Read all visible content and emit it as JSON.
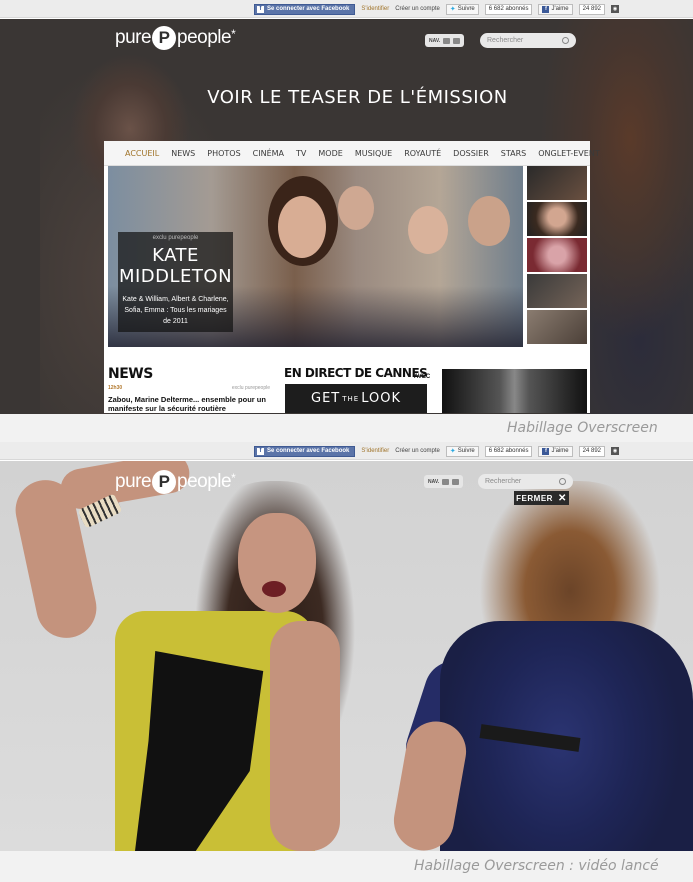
{
  "top_bar": {
    "facebook_connect": "Se connecter avec Facebook",
    "login": "S'identifier",
    "create_account": "Créer un compte",
    "twitter_follow": "Suivre",
    "twitter_count": "6 682 abonnés",
    "fb_like": "J'aime",
    "fb_like_count": "24 892"
  },
  "logo": {
    "left": "pure",
    "disc": "P",
    "right": "people",
    "star": "*"
  },
  "header": {
    "nav_label": "NAV.",
    "search_placeholder": "Rechercher"
  },
  "panel1": {
    "teaser": "VOIR LE TEASER DE L'ÉMISSION",
    "nav_items": [
      "ACCUEIL",
      "NEWS",
      "PHOTOS",
      "CINÉMA",
      "TV",
      "MODE",
      "MUSIQUE",
      "ROYAUTÉ",
      "DOSSIER",
      "STARS",
      "ONGLET-EVENT"
    ],
    "hero": {
      "exclu": "exclu purepeople",
      "name_line1": "KATE",
      "name_line2": "MIDDLETON",
      "subtitle": "Kate & William, Albert & Charlene, Sofia, Emma : Tous les mariages de 2011"
    },
    "news": {
      "title": "NEWS",
      "time": "12h30",
      "exclu": "exclu purepeople",
      "headline": "Zabou, Marine Delterme... ensemble pour un manifeste sur la sécurité routière"
    },
    "cannes": {
      "title": "EN DIRECT DE CANNES",
      "avec": "AVEC",
      "get": "GET",
      "the": "THE",
      "look": "LOOK"
    }
  },
  "captions": {
    "panel1": "Habillage Overscreen",
    "panel2": "Habillage Overscreen : vidéo lancé"
  },
  "panel2": {
    "close_label": "FERMER",
    "close_icon": "✕"
  },
  "colors": {
    "accent_gold": "#a0742a",
    "facebook_blue": "#5b74a8",
    "dark_overlay": "#3a3634"
  }
}
